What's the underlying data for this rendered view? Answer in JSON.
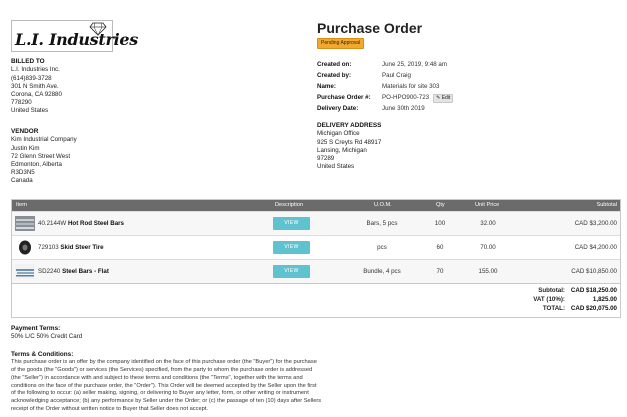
{
  "logo": {
    "text": "L.I. Industries",
    "icon": "diamond-icon"
  },
  "billed_to": {
    "title": "BILLED TO",
    "lines": [
      "L.I. Industries Inc.",
      "(614)839-3728",
      "301 N Smith Ave.",
      "Corona, CA 92880",
      "778290",
      "United States"
    ]
  },
  "vendor": {
    "title": "VENDOR",
    "lines": [
      "Kim Industrial Company",
      "Justin Kim",
      "72 Glenn Street West",
      "Edmonton, Alberta",
      "R3D3N5",
      "Canada"
    ]
  },
  "header": {
    "title": "Purchase Order",
    "status": "Pending Approval",
    "status_color": "#f0a830"
  },
  "meta": {
    "created_on_label": "Created on:",
    "created_on": "June 25, 2019, 9:48 am",
    "created_by_label": "Created by:",
    "created_by": "Paul Craig",
    "name_label": "Name:",
    "name": "Materials for site 303",
    "po_label": "Purchase Order #:",
    "po": "PO-HPO900-723",
    "edit_label": "Edit",
    "delivery_date_label": "Delivery Date:",
    "delivery_date": "June 30th 2019"
  },
  "delivery": {
    "title": "DELIVERY ADDRESS",
    "lines": [
      "Michigan Office",
      "925 S Creyts Rd 48917",
      "Lansing, Michigan",
      "97289",
      "United States"
    ]
  },
  "table": {
    "headers": {
      "item": "Item",
      "description": "Description",
      "uom": "U.O.M.",
      "qty": "Qty",
      "unit_price": "Unit Price",
      "subtotal": "Subtotal"
    },
    "view_label": "VIEW",
    "rows": [
      {
        "code": "40.2144W",
        "name": "Hot Rod Steel Bars",
        "uom": "Bars, 5 pcs",
        "qty": "100",
        "unit_price": "32.00",
        "subtotal": "CAD $3,200.00",
        "thumb": "steel-bars"
      },
      {
        "code": "729103",
        "name": "Skid Steer Tire",
        "uom": "pcs",
        "qty": "60",
        "unit_price": "70.00",
        "subtotal": "CAD $4,200.00",
        "thumb": "tire"
      },
      {
        "code": "SD2240",
        "name": "Steel Bars - Flat",
        "uom": "Bundle, 4 pcs",
        "qty": "70",
        "unit_price": "155.00",
        "subtotal": "CAD $10,850.00",
        "thumb": "flat-bars"
      }
    ],
    "totals": {
      "subtotal_label": "Subtotal:",
      "subtotal": "CAD $18,250.00",
      "vat_label": "VAT (10%):",
      "vat": "1,825.00",
      "total_label": "TOTAL:",
      "total": "CAD $20,075.00"
    }
  },
  "payment_terms": {
    "title": "Payment Terms:",
    "value": "50% L/C 50% Credit Card"
  },
  "terms": {
    "title": "Terms & Conditions:",
    "lines": [
      "This purchase order is an offer by the company identified on the face of this purchase order (the \"Buyer\") for the purchase",
      "of the goods (the \"Goods\") or services (the Services) specified, from the party to whom the purchase order is addressed",
      "(the \"Seller\") in accordance with and subject to these terms and conditions (the \"Terms\", together with the terms and",
      "conditions on the face of the purchase order, the \"Order\"). This Order will be deemed accepted by the Seller upon the first",
      "of the following to occur: (a) seller making, signing, or delivering to Buyer any letter, form, or other writing or instrument",
      "acknowledging acceptance; (b) any performance by Seller under the Order; or (c) the passage of ten (10) days after Sellers",
      "receipt of the Order without written notice to Buyer that Seller does not accept."
    ]
  }
}
